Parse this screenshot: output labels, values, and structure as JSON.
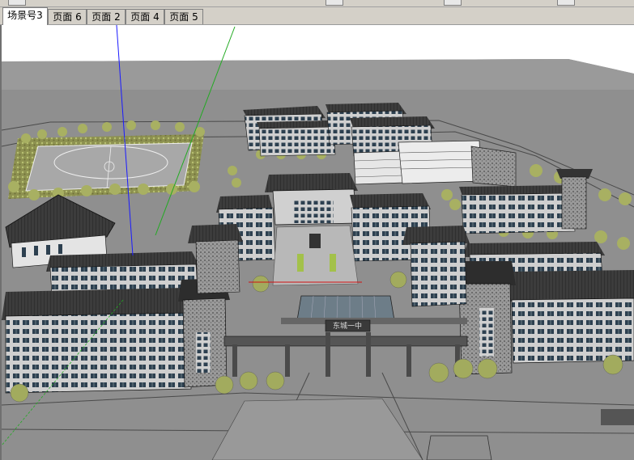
{
  "window": {
    "tabs": [
      {
        "label": "场景号3",
        "active": true
      },
      {
        "label": "页面 6",
        "active": false
      },
      {
        "label": "页面 2",
        "active": false
      },
      {
        "label": "页面 4",
        "active": false
      },
      {
        "label": "页面 5",
        "active": false
      }
    ]
  },
  "viewport": {
    "gate_sign": "东城一中",
    "axis_colors": {
      "blue": "#1a1aff",
      "green": "#22aa22",
      "red": "#d01010"
    },
    "colors": {
      "ground": "#8f8f8f",
      "sky": "#ffffff",
      "roof": "#3a3a3a",
      "wall_light": "#d8d8d8",
      "window": "#2d4050",
      "tree": "#9aa45a",
      "field": "#b0b0b0"
    }
  }
}
